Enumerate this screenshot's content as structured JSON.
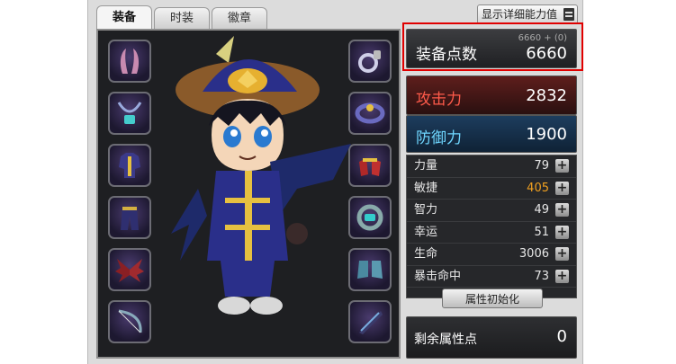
{
  "tabs": [
    {
      "label": "装备",
      "active": true
    },
    {
      "label": "时装",
      "active": false
    },
    {
      "label": "徽章",
      "active": false
    }
  ],
  "detail_button": {
    "label": "显示详细能力值"
  },
  "equipment_slots": {
    "left": [
      "horns-icon",
      "necklace-icon",
      "top-armor-icon",
      "bottom-armor-icon",
      "wings-icon",
      "bow-weapon-icon"
    ],
    "right": [
      "ring-icon",
      "belt-icon",
      "gloves-icon",
      "bracelet-icon",
      "boots-icon",
      "offhand-icon"
    ]
  },
  "stats": {
    "equip_points": {
      "label": "装备点数",
      "sub": "6660 + (0)",
      "value": "6660"
    },
    "attack": {
      "label": "攻击力",
      "value": "2832"
    },
    "defense": {
      "label": "防御力",
      "value": "1900"
    },
    "attributes": [
      {
        "name": "力量",
        "value": "79",
        "highlight": false
      },
      {
        "name": "敏捷",
        "value": "405",
        "highlight": true
      },
      {
        "name": "智力",
        "value": "49",
        "highlight": false
      },
      {
        "name": "幸运",
        "value": "51",
        "highlight": false
      },
      {
        "name": "生命",
        "value": "3006",
        "highlight": false
      },
      {
        "name": "暴击命中",
        "value": "73",
        "highlight": false
      }
    ],
    "plus_symbol": "+",
    "reset_button": "属性初始化",
    "remaining": {
      "label": "剩余属性点",
      "value": "0"
    }
  },
  "colors": {
    "highlight_outline": "#e00000",
    "attack_label": "#ff5a4a",
    "defense_label": "#6fd7ff",
    "agility_value": "#f0a020"
  }
}
